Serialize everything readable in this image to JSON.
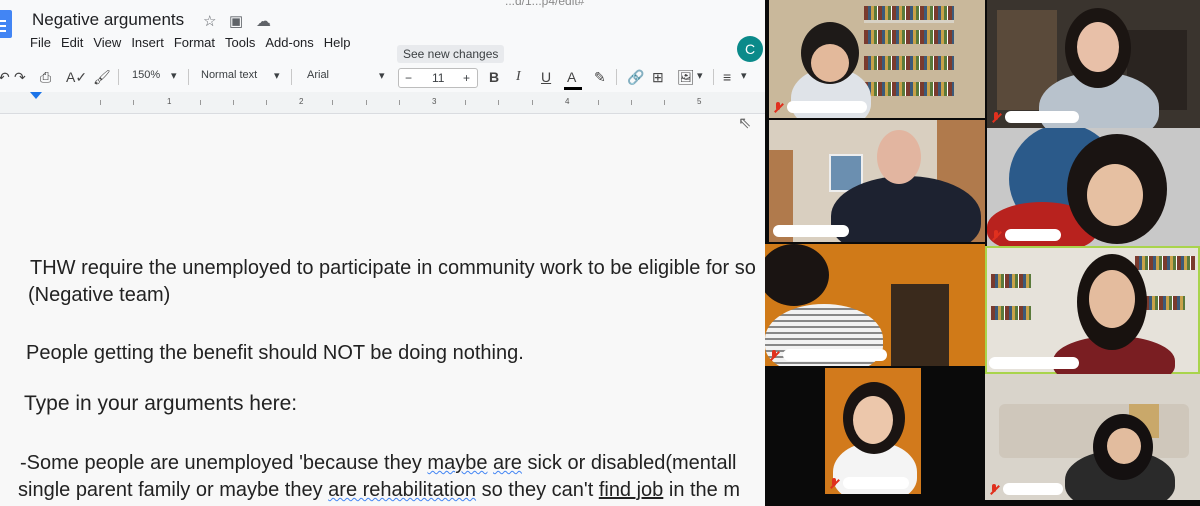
{
  "docs": {
    "url_fragment": "...d/1...p4/edit#",
    "title": "Negative arguments",
    "menu": [
      "File",
      "Edit",
      "View",
      "Insert",
      "Format",
      "Tools",
      "Add-ons",
      "Help"
    ],
    "see_new_changes": "See new changes",
    "account_initial": "C",
    "toolbar": {
      "zoom": "150%",
      "style": "Normal text",
      "font": "Arial",
      "font_size": "11",
      "minus": "−",
      "plus": "+",
      "bold": "B",
      "italic": "I",
      "underline": "U",
      "text_color": "A"
    },
    "ruler": [
      "1",
      "2",
      "3",
      "4",
      "5"
    ],
    "body": {
      "motion_line1": "THW require the unemployed to participate in community work to be eligible for so",
      "motion_line2": "(Negative team)",
      "statement": "People getting the benefit should NOT be doing nothing.",
      "prompt": "Type in your arguments here:",
      "arg_line1_a": "-Some people are unemployed 'because they ",
      "arg_line1_maybe": "maybe",
      "arg_line1_mid": " ",
      "arg_line1_are": "are",
      "arg_line1_b": " sick or disabled(mentall",
      "arg_line2_a": "single parent family or maybe they ",
      "arg_line2_squig": "are rehabilitation",
      "arg_line2_b": " so they can't ",
      "arg_line2_find": "find job",
      "arg_line2_c": " in the m"
    }
  },
  "zoom": {
    "tiles": [
      {
        "id": "p1",
        "muted": true,
        "active": false
      },
      {
        "id": "p2",
        "muted": true,
        "active": false
      },
      {
        "id": "p3",
        "muted": false,
        "active": false
      },
      {
        "id": "p4",
        "muted": true,
        "active": false
      },
      {
        "id": "p5",
        "muted": true,
        "active": false
      },
      {
        "id": "p6",
        "muted": false,
        "active": true
      },
      {
        "id": "p7",
        "muted": true,
        "active": false
      },
      {
        "id": "p8",
        "muted": true,
        "active": false
      }
    ]
  },
  "colors": {
    "docs_blue": "#4285f4",
    "avatar_teal": "#0b8a8a",
    "mute_red": "#e0301e",
    "active_speaker": "#a9d44c"
  }
}
